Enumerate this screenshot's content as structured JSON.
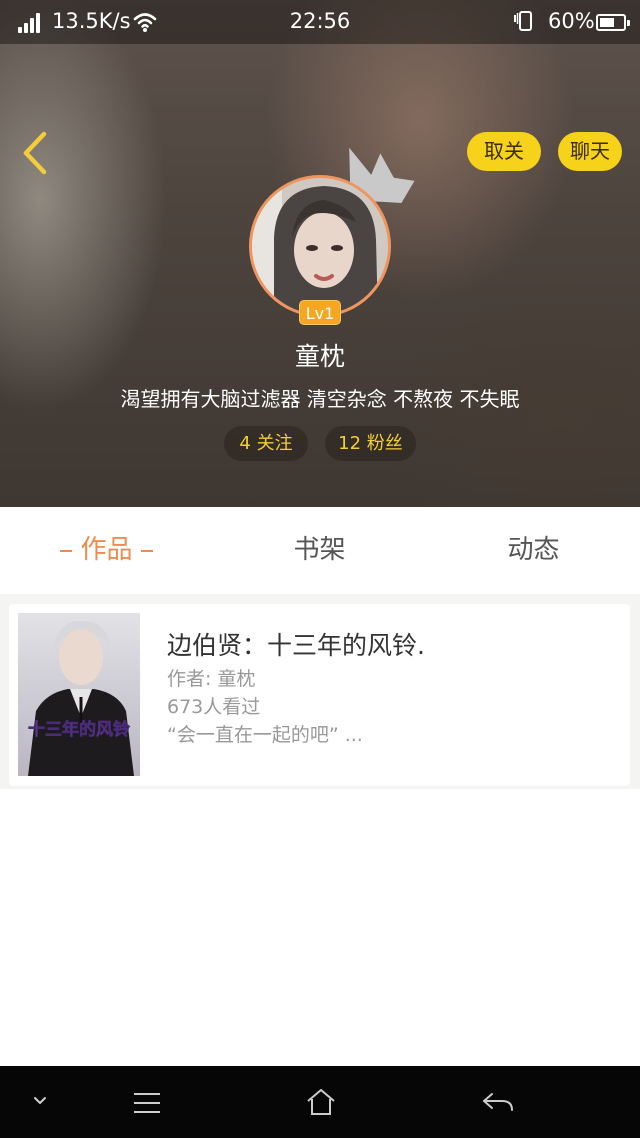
{
  "status_bar": {
    "net_speed": "13.5K/s",
    "time": "22:56",
    "battery": "60%"
  },
  "header": {
    "unfollow_label": "取关",
    "chat_label": "聊天"
  },
  "profile": {
    "level": "Lv1",
    "name": "童枕",
    "bio": "渴望拥有大脑过滤器 清空杂念 不熬夜 不失眠",
    "following": "4 关注",
    "followers": "12 粉丝"
  },
  "tabs": [
    {
      "label": "作品",
      "active": true
    },
    {
      "label": "书架",
      "active": false
    },
    {
      "label": "动态",
      "active": false
    }
  ],
  "works": [
    {
      "title": "边伯贤：十三年的风铃.",
      "author": "作者: 童枕",
      "views": "673人看过",
      "excerpt": "“会一直在一起的吧” ...",
      "cover_text": "十三年的风铃"
    }
  ],
  "colors": {
    "accent_orange": "#f08b4e",
    "button_yellow": "#f6d21a",
    "stat_text_yellow": "#f3cd3a",
    "level_badge": "#f5a623"
  }
}
